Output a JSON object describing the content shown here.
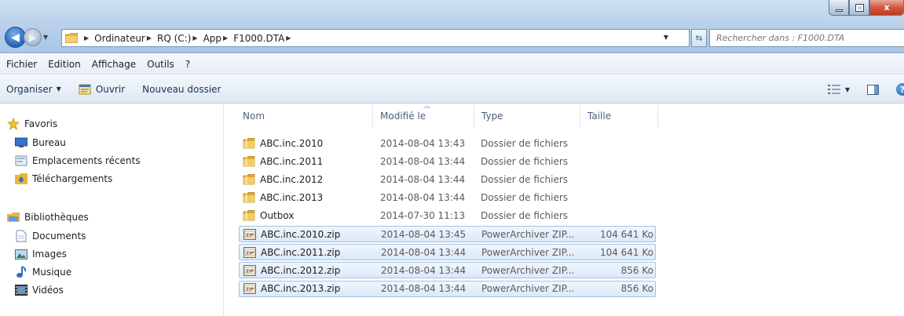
{
  "window": {
    "min_label": "",
    "max_label": "",
    "close_label": "x"
  },
  "address": {
    "breadcrumbs": [
      {
        "label": "Ordinateur"
      },
      {
        "label": "RQ (C:)"
      },
      {
        "label": "App"
      },
      {
        "label": "F1000.DTA"
      }
    ]
  },
  "search": {
    "placeholder": "Rechercher dans : F1000.DTA"
  },
  "menu": [
    "Fichier",
    "Edition",
    "Affichage",
    "Outils",
    "?"
  ],
  "commands": {
    "organize": "Organiser",
    "open": "Ouvrir",
    "new_folder": "Nouveau dossier"
  },
  "nav": {
    "favorites": {
      "label": "Favoris",
      "items": [
        "Bureau",
        "Emplacements récents",
        "Téléchargements"
      ]
    },
    "libraries": {
      "label": "Bibliothèques",
      "items": [
        "Documents",
        "Images",
        "Musique",
        "Vidéos"
      ]
    }
  },
  "columns": {
    "name": "Nom",
    "modified": "Modifié le",
    "type": "Type",
    "size": "Taille"
  },
  "files": [
    {
      "name": "ABC.inc.2010",
      "modified": "2014-08-04 13:43",
      "type": "Dossier de fichiers",
      "size": "",
      "kind": "folder",
      "selected": false
    },
    {
      "name": "ABC.inc.2011",
      "modified": "2014-08-04 13:44",
      "type": "Dossier de fichiers",
      "size": "",
      "kind": "folder",
      "selected": false
    },
    {
      "name": "ABC.inc.2012",
      "modified": "2014-08-04 13:44",
      "type": "Dossier de fichiers",
      "size": "",
      "kind": "folder",
      "selected": false
    },
    {
      "name": "ABC.inc.2013",
      "modified": "2014-08-04 13:44",
      "type": "Dossier de fichiers",
      "size": "",
      "kind": "folder",
      "selected": false
    },
    {
      "name": "Outbox",
      "modified": "2014-07-30 11:13",
      "type": "Dossier de fichiers",
      "size": "",
      "kind": "folder",
      "selected": false
    },
    {
      "name": "ABC.inc.2010.zip",
      "modified": "2014-08-04 13:45",
      "type": "PowerArchiver ZIP...",
      "size": "104 641 Ko",
      "kind": "zip",
      "selected": true
    },
    {
      "name": "ABC.inc.2011.zip",
      "modified": "2014-08-04 13:44",
      "type": "PowerArchiver ZIP...",
      "size": "104 641 Ko",
      "kind": "zip",
      "selected": true
    },
    {
      "name": "ABC.inc.2012.zip",
      "modified": "2014-08-04 13:44",
      "type": "PowerArchiver ZIP...",
      "size": "856 Ko",
      "kind": "zip",
      "selected": true
    },
    {
      "name": "ABC.inc.2013.zip",
      "modified": "2014-08-04 13:44",
      "type": "PowerArchiver ZIP...",
      "size": "856 Ko",
      "kind": "zip",
      "selected": true
    }
  ],
  "colors": {
    "selection_bg": "#dce9f8",
    "selection_border": "#a5c3e4",
    "folder": "#e8b53a",
    "chrome": "#b9d1ea"
  }
}
